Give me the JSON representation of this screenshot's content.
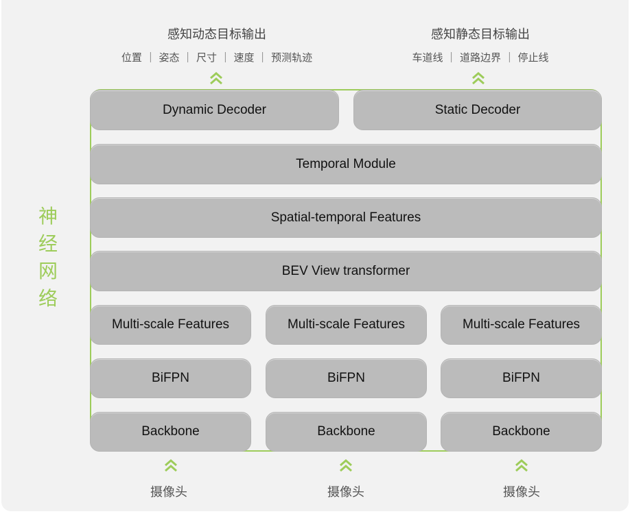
{
  "outputs": {
    "dynamic": {
      "title": "感知动态目标输出",
      "subtitle": "位置 ｜ 姿态 ｜ 尺寸 ｜ 速度 ｜ 预测轨迹"
    },
    "static": {
      "title": "感知静态目标输出",
      "subtitle": "车道线 ｜ 道路边界 ｜ 停止线"
    }
  },
  "side_label": [
    "神",
    "经",
    "网",
    "络"
  ],
  "modules": {
    "dynamic_decoder": "Dynamic Decoder",
    "static_decoder": "Static Decoder",
    "temporal_module": "Temporal Module",
    "spatial_temporal": "Spatial-temporal Features",
    "bev_transformer": "BEV View transformer",
    "columns": [
      {
        "multi_scale": "Multi-scale Features",
        "bifpn": "BiFPN",
        "backbone": "Backbone",
        "input": "摄像头"
      },
      {
        "multi_scale": "Multi-scale Features",
        "bifpn": "BiFPN",
        "backbone": "Backbone",
        "input": "摄像头"
      },
      {
        "multi_scale": "Multi-scale Features",
        "bifpn": "BiFPN",
        "backbone": "Backbone",
        "input": "摄像头"
      }
    ]
  },
  "colors": {
    "accent": "#9dcc5a",
    "box": "#bbbbbb",
    "background": "#f2f2f2"
  }
}
